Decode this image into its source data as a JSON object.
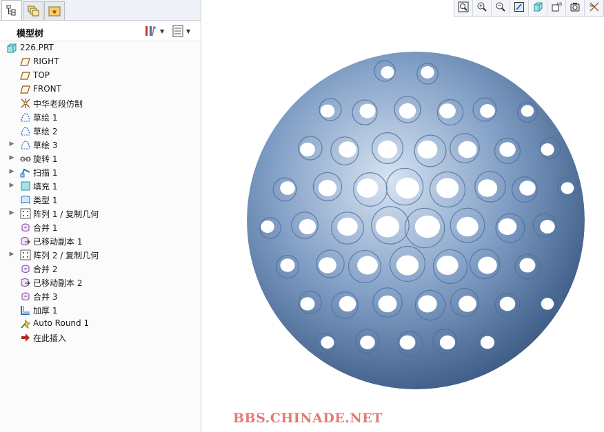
{
  "panel": {
    "tabs": [
      {
        "icon": "model-tree-tab-icon"
      },
      {
        "icon": "layers-tab-icon"
      },
      {
        "icon": "folder-browser-tab-icon"
      }
    ],
    "title": "模型树",
    "settings_icon": "tree-settings-icon",
    "columns_icon": "tree-columns-icon"
  },
  "tree": {
    "root": {
      "label": "226.PRT",
      "icon": "part-icon"
    },
    "items": [
      {
        "label": "RIGHT",
        "icon": "datum-plane-icon",
        "expandable": false
      },
      {
        "label": "TOP",
        "icon": "datum-plane-icon",
        "expandable": false
      },
      {
        "label": "FRONT",
        "icon": "datum-plane-icon",
        "expandable": false
      },
      {
        "label": "中华老段仿制",
        "icon": "csys-icon",
        "expandable": false
      },
      {
        "label": "草绘 1",
        "icon": "sketch-icon",
        "expandable": false
      },
      {
        "label": "草绘 2",
        "icon": "sketch-icon",
        "expandable": false
      },
      {
        "label": "草绘 3",
        "icon": "sketch-icon",
        "expandable": true
      },
      {
        "label": "旋转 1",
        "icon": "revolve-icon",
        "expandable": true
      },
      {
        "label": "扫描 1",
        "icon": "sweep-icon",
        "expandable": true
      },
      {
        "label": "填充 1",
        "icon": "fill-icon",
        "expandable": true
      },
      {
        "label": "类型 1",
        "icon": "boundary-icon",
        "expandable": false
      },
      {
        "label": "阵列 1 / 复制几何",
        "icon": "pattern-icon",
        "expandable": true
      },
      {
        "label": "合并 1",
        "icon": "merge-icon",
        "expandable": false
      },
      {
        "label": "已移动副本 1",
        "icon": "moved-copy-icon",
        "expandable": false
      },
      {
        "label": "阵列 2 / 复制几何",
        "icon": "pattern-icon",
        "expandable": true
      },
      {
        "label": "合并 2",
        "icon": "merge-icon",
        "expandable": false
      },
      {
        "label": "已移动副本 2",
        "icon": "moved-copy-icon",
        "expandable": false
      },
      {
        "label": "合并 3",
        "icon": "merge-icon",
        "expandable": false
      },
      {
        "label": "加厚 1",
        "icon": "thicken-icon",
        "expandable": false
      },
      {
        "label": "Auto Round 1",
        "icon": "auto-round-icon",
        "expandable": false
      },
      {
        "label": "在此插入",
        "icon": "insert-here-arrow-icon",
        "expandable": false
      }
    ]
  },
  "toolbar": {
    "buttons": [
      "refit-icon",
      "zoom-in-icon",
      "zoom-out-icon",
      "repaint-icon",
      "saved-view-icon",
      "annotation-display-icon",
      "spin-center-icon",
      "datum-display-icon"
    ]
  },
  "viewport": {
    "model_color": "#6f8fb8",
    "watermark": "BBS.CHINADE.NET"
  },
  "colors": {
    "panel_bg": "#fbfbfb",
    "accent_blue": "#2a6fc9",
    "watermark": "#e47a72"
  }
}
